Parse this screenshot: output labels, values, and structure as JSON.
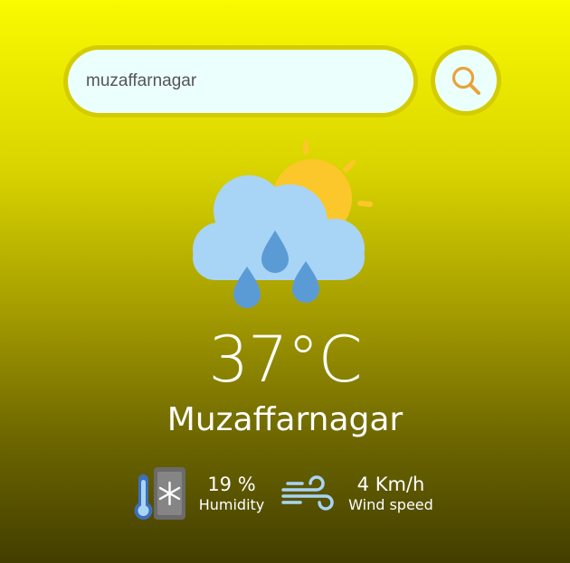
{
  "search": {
    "value": "muzaffarnagar",
    "button_icon": "search-icon"
  },
  "weather": {
    "icon": "rain-cloud-sun-icon",
    "temperature": "37°C",
    "city": "Muzaffarnagar"
  },
  "details": {
    "humidity": {
      "icon": "thermometer-snowflake-icon",
      "value": "19 %",
      "label": "Humidity"
    },
    "wind": {
      "icon": "wind-icon",
      "value": "4 Km/h",
      "label": "Wind speed"
    }
  },
  "colors": {
    "gradient_top": "#fafa00",
    "gradient_bottom": "#423e00",
    "input_background": "#ebfffc",
    "search_icon": "#e8a33a",
    "cloud": "#a8d4f5",
    "sun": "#fcc72a",
    "raindrop": "#5b9bd5"
  }
}
